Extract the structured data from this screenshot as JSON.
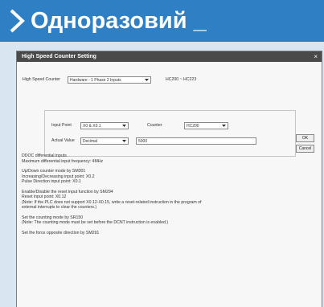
{
  "banner": {
    "title": "Одноразовий _"
  },
  "dialog": {
    "title": "High Speed Counter Setting",
    "close_label": "×",
    "hsc_label": "High Speed Counter",
    "hsc_value": "Hardware - 1 Phase 2 Inputs",
    "hsc_range": "HC200 ~ HC223",
    "input_point_label": "Input Point",
    "input_point_value": "X0 & X0.1",
    "counter_label": "Counter",
    "counter_value": "HC200",
    "actual_value_label": "Actual Value",
    "actual_value_format": "Decimal",
    "actual_value_input": "5000",
    "ok_label": "OK",
    "cancel_label": "Cancel",
    "description": [
      "DDOC differential inputs",
      "Maximum differential input frequency: 4MHz",
      "",
      "Up/Down counter mode by SM301",
      "Increasing/Decreasing input point: X0.2",
      "Pulse Direction input point: X0.1",
      "",
      "Enable/Disable the reset input function by SM294",
      "Reset input point: X0.12",
      "(Note: If the PLC does not support X0.12-X0.15, write a reset-related instruction in the program of",
      "external interrupts to clear the counters.)",
      "",
      "Set the counting mode by SR150",
      "(Note: The counting mode must be set before the DCNT instruction is enabled.)",
      "",
      "Set the force opposite direction by SM291"
    ]
  }
}
